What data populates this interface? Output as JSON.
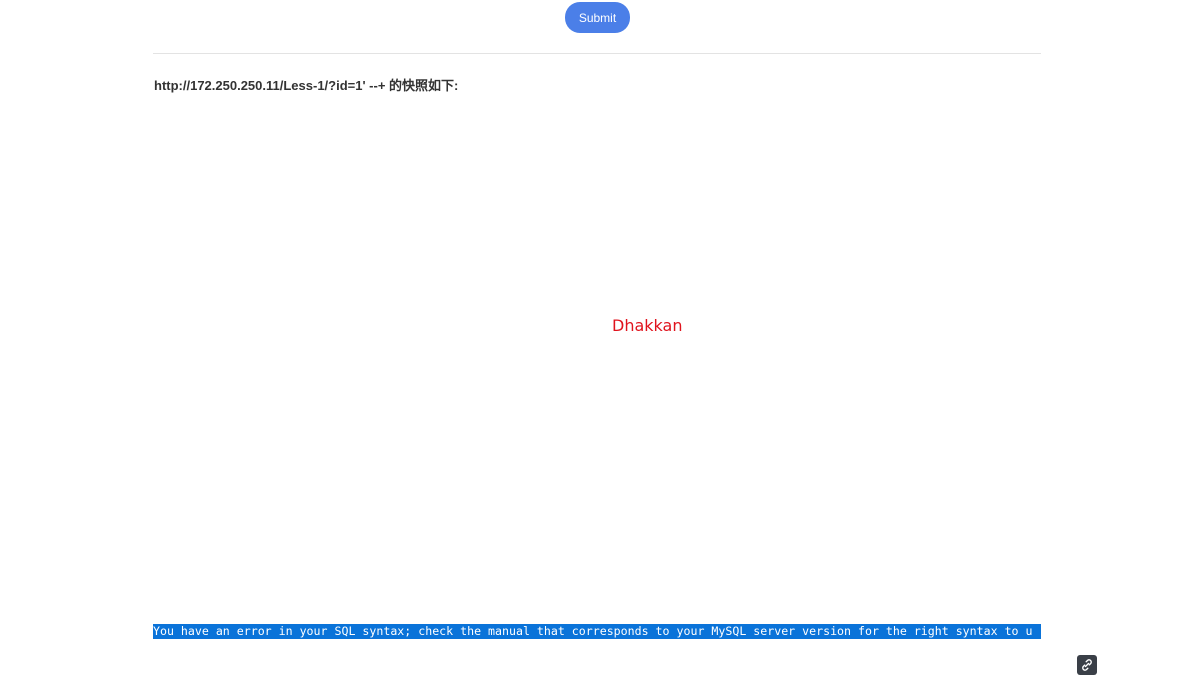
{
  "form": {
    "submit_label": "Submit"
  },
  "snapshot": {
    "heading": "http://172.250.250.11/Less-1/?id=1' --+ 的快照如下:",
    "frame": {
      "brand_text": "Dhakkan",
      "brand_color": "#e0131d",
      "error_text": "You have an error in your SQL syntax; check the manual that corresponds to your MySQL server version for the right syntax to u",
      "selection_color": "#0a73d9"
    }
  },
  "floating_tool": {
    "icon": "link-icon"
  },
  "colors": {
    "accent": "#4b7fe8"
  }
}
